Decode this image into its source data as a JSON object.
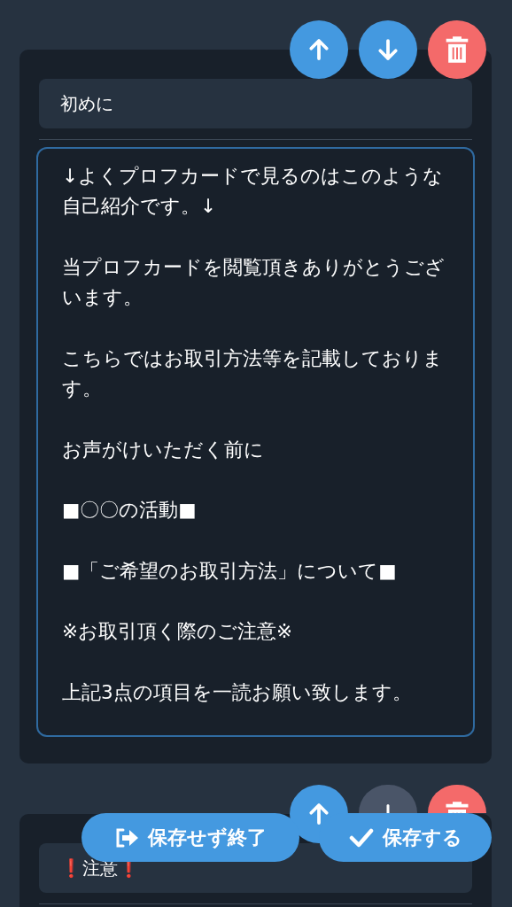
{
  "sections": [
    {
      "title": "初めに",
      "paragraphs": [
        "↓よくプロフカードで見るのはこのような自己紹介です。↓",
        "当プロフカードを閲覧頂きありがとうございます。",
        "こちらではお取引方法等を記載しております。",
        "お声がけいただく前に",
        "■〇〇の活動■",
        "■「ご希望のお取引方法」について■",
        "※お取引頂く際のご注意※",
        "上記3点の項目を一読お願い致します。"
      ],
      "move_up_disabled": false,
      "move_down_disabled": false
    },
    {
      "title": "❗注意❗",
      "move_up_disabled": false,
      "move_down_disabled": true
    }
  ],
  "actions": [
    {
      "kind": "exit",
      "label": "保存せず終了"
    },
    {
      "kind": "save",
      "label": "保存する"
    }
  ]
}
